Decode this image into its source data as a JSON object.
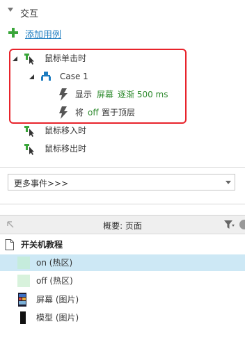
{
  "interactions": {
    "section_title": "交互",
    "add_case_label": "添加用例",
    "events": [
      {
        "label": "鼠标单击时",
        "case_label": "Case 1",
        "actions": [
          {
            "verb": "显示",
            "target": "屏幕",
            "detail": "逐渐 500 ms"
          },
          {
            "verb": "将",
            "target": "off",
            "detail": "置于顶层"
          }
        ]
      },
      {
        "label": "鼠标移入时"
      },
      {
        "label": "鼠标移出时"
      }
    ],
    "more_events_label": "更多事件>>>"
  },
  "outline": {
    "title": "概要: 页面",
    "page_name": "开关机教程",
    "items": [
      {
        "label": "on (热区)",
        "selected": true
      },
      {
        "label": "off (热区)",
        "selected": false
      },
      {
        "label": "屏幕 (图片)",
        "selected": false
      },
      {
        "label": "模型 (图片)",
        "selected": false
      }
    ]
  },
  "colors": {
    "accent_link": "#1c7cc0",
    "action_green": "#2f8b2f",
    "highlight_red": "#e8232b",
    "selection_blue": "#cde8f5",
    "hotspot_green": "#d3f0dc"
  },
  "icons": {
    "event_icon": "event-cursor-icon",
    "case_icon": "case-tree-icon",
    "action_icon": "lightning-icon",
    "filter_icon": "filter-icon",
    "page_icon": "page-icon"
  }
}
